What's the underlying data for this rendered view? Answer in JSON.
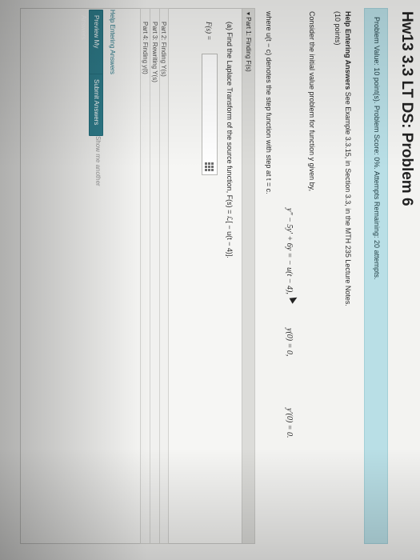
{
  "title": "Hw13 3.3 LT DS: Problem 6",
  "banner": {
    "text": "Problem Value: 10 point(s). Problem Score: 0%. Attempts Remaining: 20 attempts."
  },
  "help": {
    "label": "Help Entering Answers",
    "text": "See Example 3.3.15, in Section 3.3, in the MTH 235 Lecture Notes.",
    "points": "(10 points)"
  },
  "problem": {
    "intro": "Consider the initial value problem for function y given by,",
    "equation": "y″ − 5y′ + 6y = − u(t − 4),",
    "cond1": "y(0) = 0,",
    "cond2": "y′(0) = 0.",
    "where": "where u(t − c) denotes the step function with step at t = c."
  },
  "part1": {
    "header": "Part 1: Finding F(s)",
    "question": "(a) Find the Laplace Transform of the source function, F(s) = ℒ[ − u(t − 4)].",
    "answer_label": "F(s) =",
    "answer_value": ""
  },
  "other_parts": [
    "Part 2: Finding Y(s)",
    "Part 3: Rewriting Y(s)",
    "Part 4: Finding y(t)"
  ],
  "footer": {
    "help_link": "Help Entering Answers",
    "preview_button": "Preview My Answers",
    "submit_button": "Submit Answers",
    "show_another": "Show me another"
  },
  "colors": {
    "banner_bg": "#b9dfe6",
    "button_bg": "#2f7f8e",
    "page_bg": "#f3f3f1"
  }
}
